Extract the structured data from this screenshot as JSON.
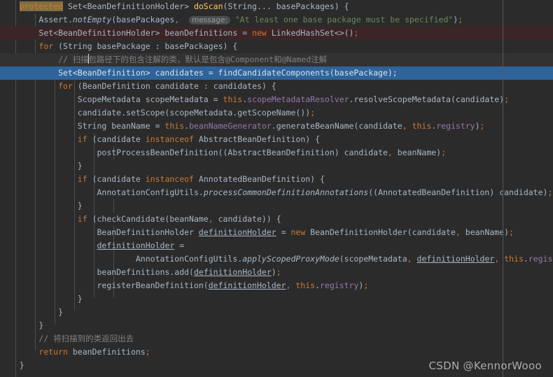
{
  "editor": {
    "theme_name": "darcula",
    "background": "#2b2b2b",
    "selected_line_color": "#2f6399",
    "modified_line_color": "#3b2526",
    "margin_guide_color": "#555759",
    "search_highlight_color": "#7f6f40"
  },
  "watermark": {
    "text": "CSDN @KennorWooo"
  },
  "code": {
    "language": "java",
    "lines": [
      {
        "n": 1,
        "bg": "none",
        "text": "    protected Set<BeanDefinitionHolder> doScan(String... basePackages) {"
      },
      {
        "n": 2,
        "bg": "none",
        "text": "        Assert.notEmpty(basePackages,  message: \"At least one base package must be specified\");"
      },
      {
        "n": 3,
        "bg": "modified",
        "text": "        Set<BeanDefinitionHolder> beanDefinitions = new LinkedHashSet<>();"
      },
      {
        "n": 4,
        "bg": "none",
        "text": "        for (String basePackage : basePackages) {"
      },
      {
        "n": 5,
        "bg": "comment",
        "text": "            // 扫描包路径下的包含注解的类，默认是包含@Component和@Named注解"
      },
      {
        "n": 6,
        "bg": "selected",
        "text": "            Set<BeanDefinition> candidates = findCandidateComponents(basePackage);"
      },
      {
        "n": 7,
        "bg": "none",
        "text": "            for (BeanDefinition candidate : candidates) {"
      },
      {
        "n": 8,
        "bg": "none",
        "text": "                ScopeMetadata scopeMetadata = this.scopeMetadataResolver.resolveScopeMetadata(candidate);"
      },
      {
        "n": 9,
        "bg": "none",
        "text": "                candidate.setScope(scopeMetadata.getScopeName());"
      },
      {
        "n": 10,
        "bg": "none",
        "text": "                String beanName = this.beanNameGenerator.generateBeanName(candidate, this.registry);"
      },
      {
        "n": 11,
        "bg": "none",
        "text": "                if (candidate instanceof AbstractBeanDefinition) {"
      },
      {
        "n": 12,
        "bg": "none",
        "text": "                    postProcessBeanDefinition((AbstractBeanDefinition) candidate, beanName);"
      },
      {
        "n": 13,
        "bg": "none",
        "text": "                }"
      },
      {
        "n": 14,
        "bg": "none",
        "text": "                if (candidate instanceof AnnotatedBeanDefinition) {"
      },
      {
        "n": 15,
        "bg": "none",
        "text": "                    AnnotationConfigUtils.processCommonDefinitionAnnotations((AnnotatedBeanDefinition) candidate);"
      },
      {
        "n": 16,
        "bg": "none",
        "text": "                }"
      },
      {
        "n": 17,
        "bg": "none",
        "text": "                if (checkCandidate(beanName, candidate)) {"
      },
      {
        "n": 18,
        "bg": "none",
        "text": "                    BeanDefinitionHolder definitionHolder = new BeanDefinitionHolder(candidate, beanName);"
      },
      {
        "n": 19,
        "bg": "none",
        "text": "                    definitionHolder ="
      },
      {
        "n": 20,
        "bg": "none",
        "text": "                            AnnotationConfigUtils.applyScopedProxyMode(scopeMetadata, definitionHolder, this.registry);"
      },
      {
        "n": 21,
        "bg": "none",
        "text": "                    beanDefinitions.add(definitionHolder);"
      },
      {
        "n": 22,
        "bg": "none",
        "text": "                    registerBeanDefinition(definitionHolder, this.registry);"
      },
      {
        "n": 23,
        "bg": "none",
        "text": "                }"
      },
      {
        "n": 24,
        "bg": "none",
        "text": "            }"
      },
      {
        "n": 25,
        "bg": "none",
        "text": "        }"
      },
      {
        "n": 26,
        "bg": "none",
        "text": "        // 将扫描到的类返回出去"
      },
      {
        "n": 27,
        "bg": "none",
        "text": "        return beanDefinitions;"
      },
      {
        "n": 28,
        "bg": "none",
        "text": "    }"
      }
    ],
    "inlay_hints": [
      {
        "line": 2,
        "label": "message:"
      }
    ],
    "search_highlighted_token": "protected",
    "caret_line": 5,
    "selected_line": 6
  }
}
